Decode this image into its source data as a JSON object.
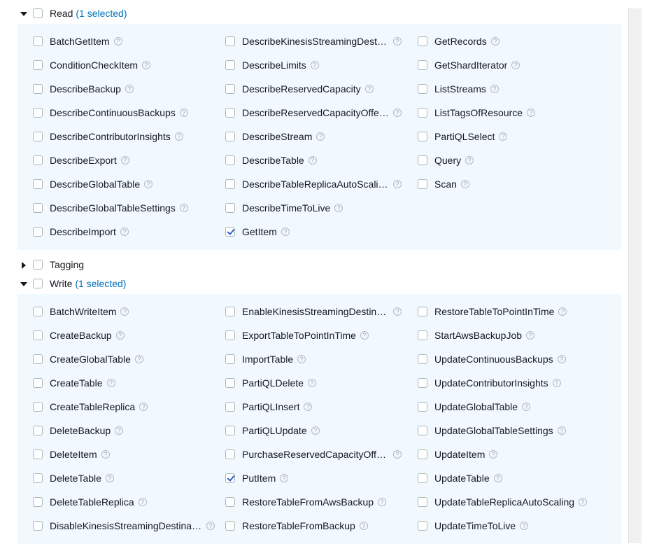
{
  "groups": [
    {
      "id": "read",
      "expanded": true,
      "label": "Read",
      "selected_text": "(1 selected)",
      "columns": [
        [
          {
            "label": "BatchGetItem",
            "checked": false
          },
          {
            "label": "ConditionCheckItem",
            "checked": false
          },
          {
            "label": "DescribeBackup",
            "checked": false
          },
          {
            "label": "DescribeContinuousBackups",
            "checked": false
          },
          {
            "label": "DescribeContributorInsights",
            "checked": false
          },
          {
            "label": "DescribeExport",
            "checked": false
          },
          {
            "label": "DescribeGlobalTable",
            "checked": false
          },
          {
            "label": "DescribeGlobalTableSettings",
            "checked": false
          },
          {
            "label": "DescribeImport",
            "checked": false
          }
        ],
        [
          {
            "label": "DescribeKinesisStreamingDestina...",
            "checked": false
          },
          {
            "label": "DescribeLimits",
            "checked": false
          },
          {
            "label": "DescribeReservedCapacity",
            "checked": false
          },
          {
            "label": "DescribeReservedCapacityOfferin...",
            "checked": false
          },
          {
            "label": "DescribeStream",
            "checked": false
          },
          {
            "label": "DescribeTable",
            "checked": false
          },
          {
            "label": "DescribeTableReplicaAutoScaling",
            "checked": false
          },
          {
            "label": "DescribeTimeToLive",
            "checked": false
          },
          {
            "label": "GetItem",
            "checked": true
          }
        ],
        [
          {
            "label": "GetRecords",
            "checked": false
          },
          {
            "label": "GetShardIterator",
            "checked": false
          },
          {
            "label": "ListStreams",
            "checked": false
          },
          {
            "label": "ListTagsOfResource",
            "checked": false
          },
          {
            "label": "PartiQLSelect",
            "checked": false
          },
          {
            "label": "Query",
            "checked": false
          },
          {
            "label": "Scan",
            "checked": false
          }
        ]
      ]
    },
    {
      "id": "tagging",
      "expanded": false,
      "label": "Tagging",
      "selected_text": "",
      "columns": []
    },
    {
      "id": "write",
      "expanded": true,
      "label": "Write",
      "selected_text": "(1 selected)",
      "columns": [
        [
          {
            "label": "BatchWriteItem",
            "checked": false
          },
          {
            "label": "CreateBackup",
            "checked": false
          },
          {
            "label": "CreateGlobalTable",
            "checked": false
          },
          {
            "label": "CreateTable",
            "checked": false
          },
          {
            "label": "CreateTableReplica",
            "checked": false
          },
          {
            "label": "DeleteBackup",
            "checked": false
          },
          {
            "label": "DeleteItem",
            "checked": false
          },
          {
            "label": "DeleteTable",
            "checked": false
          },
          {
            "label": "DeleteTableReplica",
            "checked": false
          },
          {
            "label": "DisableKinesisStreamingDestination",
            "checked": false
          }
        ],
        [
          {
            "label": "EnableKinesisStreamingDestination",
            "checked": false
          },
          {
            "label": "ExportTableToPointInTime",
            "checked": false
          },
          {
            "label": "ImportTable",
            "checked": false
          },
          {
            "label": "PartiQLDelete",
            "checked": false
          },
          {
            "label": "PartiQLInsert",
            "checked": false
          },
          {
            "label": "PartiQLUpdate",
            "checked": false
          },
          {
            "label": "PurchaseReservedCapacityOfferi...",
            "checked": false
          },
          {
            "label": "PutItem",
            "checked": true
          },
          {
            "label": "RestoreTableFromAwsBackup",
            "checked": false
          },
          {
            "label": "RestoreTableFromBackup",
            "checked": false
          }
        ],
        [
          {
            "label": "RestoreTableToPointInTime",
            "checked": false
          },
          {
            "label": "StartAwsBackupJob",
            "checked": false
          },
          {
            "label": "UpdateContinuousBackups",
            "checked": false
          },
          {
            "label": "UpdateContributorInsights",
            "checked": false
          },
          {
            "label": "UpdateGlobalTable",
            "checked": false
          },
          {
            "label": "UpdateGlobalTableSettings",
            "checked": false
          },
          {
            "label": "UpdateItem",
            "checked": false
          },
          {
            "label": "UpdateTable",
            "checked": false
          },
          {
            "label": "UpdateTableReplicaAutoScaling",
            "checked": false
          },
          {
            "label": "UpdateTimeToLive",
            "checked": false
          }
        ]
      ]
    }
  ],
  "help_icon_glyph": "?",
  "colors": {
    "panel_bg": "#f1f8fe",
    "selected_count": "#0073bb",
    "checkmark": "#2b5fc4"
  }
}
